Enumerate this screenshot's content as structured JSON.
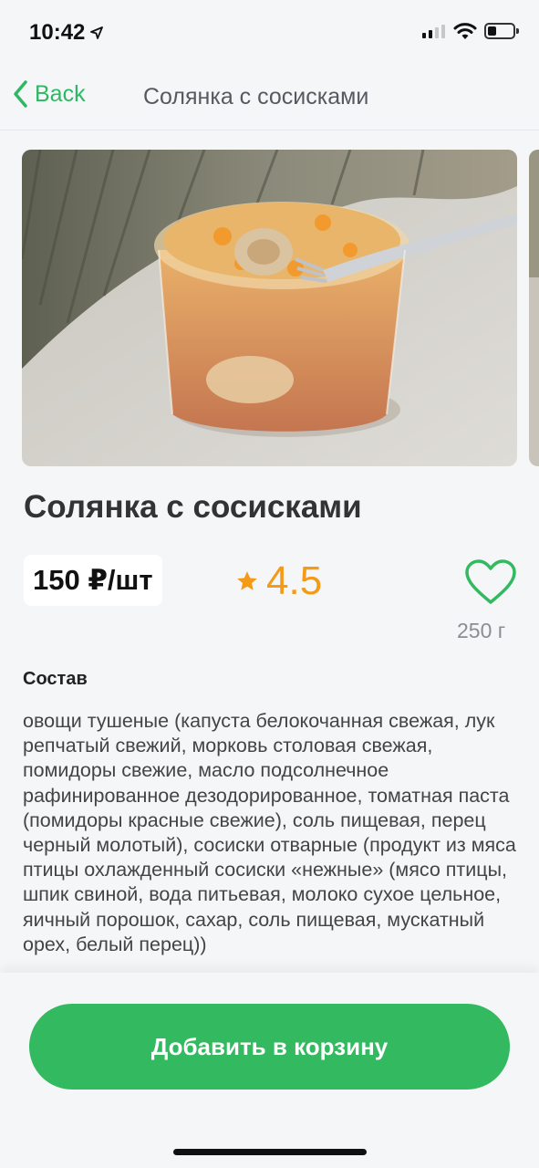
{
  "status_bar": {
    "time": "10:42"
  },
  "navbar": {
    "back_label": "Back",
    "title": "Солянка с сосисками"
  },
  "product": {
    "title": "Солянка с сосисками",
    "price": "150 ₽/шт",
    "rating": "4.5",
    "weight": "250 г",
    "composition_title": "Состав",
    "composition_text": "овощи тушеные (капуста белокочанная свежая, лук репчатый свежий, морковь столовая свежая, помидоры свежие, масло подсолнечное рафинированное дезодорированное, томатная паста (помидоры красные свежие), соль пищевая, перец черный молотый), сосиски отварные (продукт из мяса птицы охлажденный  сосиски «нежные» (мясо птицы, шпик свиной, вода питьевая, молоко сухое цельное, яичный порошок, сахар, соль пищевая, мускатный орех, белый перец))"
  },
  "actions": {
    "add_to_cart": "Добавить в корзину"
  },
  "icons": {
    "back": "chevron-left-icon",
    "star": "star-icon",
    "favorite": "heart-icon",
    "location": "location-arrow-icon",
    "wifi": "wifi-icon",
    "signal": "signal-icon",
    "battery": "battery-icon"
  },
  "colors": {
    "accent": "#33b960",
    "rating": "#f49a16",
    "back": "#2fb765"
  }
}
